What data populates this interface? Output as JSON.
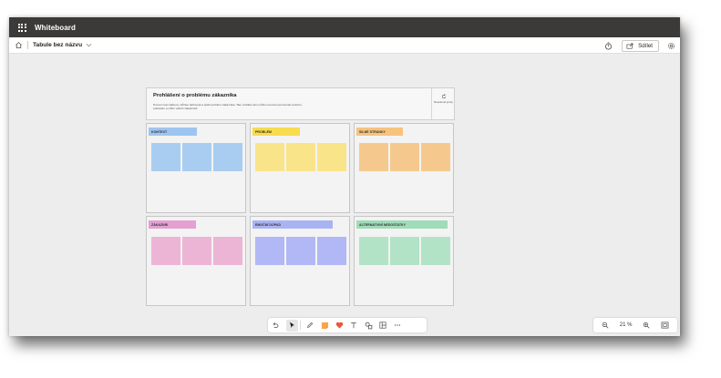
{
  "app": {
    "title": "Whiteboard"
  },
  "commandbar": {
    "board_name": "Tabule bez názvu",
    "share_label": "Sdílet"
  },
  "template": {
    "title": "Prohlášení o problému zákazníka",
    "description": "Pomocí této šablony můžete definovat a zjistit problém zákazníka. Tato vodítka vám můžou pomoct porozumět pozicím, potřebám a cílům vašich zákazníků.",
    "reset_label": "Resetovat prvky",
    "panels": [
      {
        "label": "KONTEXT",
        "tag_color": "#9ec5f0",
        "note_color": "#a9cdf0",
        "notes": 3
      },
      {
        "label": "PROBLÉM",
        "tag_color": "#f7dc4d",
        "note_color": "#f9e48a",
        "notes": 3
      },
      {
        "label": "SILNÉ STRÁNKY",
        "tag_color": "#f7c37e",
        "note_color": "#f5c98e",
        "notes": 3
      },
      {
        "label": "ZÁKAZNÍK",
        "tag_color": "#e3a0d1",
        "note_color": "#ecb5d6",
        "notes": 3
      },
      {
        "label": "EMOČNÍ DOPAD",
        "tag_color": "#aab3f2",
        "note_color": "#b1b8f5",
        "notes": 3
      },
      {
        "label": "ALTERNATIVNÍ NEDOSTATKY",
        "tag_color": "#9fdcb7",
        "note_color": "#b3e3c7",
        "notes": 3
      }
    ]
  },
  "toolbar": {
    "tools": [
      "undo-icon",
      "select-icon",
      "pen-icon",
      "sticky-note-icon",
      "reaction-heart-icon",
      "text-icon",
      "shapes-icon",
      "template-icon",
      "more-icon"
    ],
    "accent_heart": "#e8593b",
    "accent_note": "#f8a84a"
  },
  "zoom": {
    "value": "21 %"
  }
}
